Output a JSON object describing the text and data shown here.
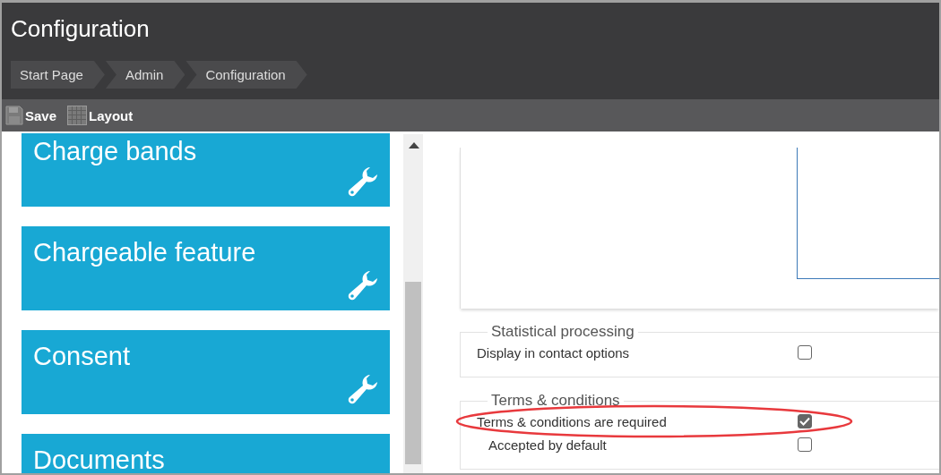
{
  "window": {
    "title": "Configuration"
  },
  "breadcrumbs": [
    "Start Page",
    "Admin",
    "Configuration"
  ],
  "toolbar": [
    {
      "label": "Save",
      "kind": "save"
    },
    {
      "label": "Layout",
      "kind": "layout"
    }
  ],
  "tiles": [
    {
      "label": "Charge bands"
    },
    {
      "label": "Chargeable feature"
    },
    {
      "label": "Consent"
    },
    {
      "label": "Documents"
    }
  ],
  "sections": [
    {
      "legend": "Statistical processing",
      "options": [
        {
          "label": "Display in contact options",
          "checked": false,
          "indented": false,
          "highlighted": false
        }
      ]
    },
    {
      "legend": "Terms & conditions",
      "options": [
        {
          "label": "Terms & conditions are required",
          "checked": true,
          "indented": false,
          "highlighted": true
        },
        {
          "label": "Accepted by default",
          "checked": false,
          "indented": true,
          "highlighted": false
        }
      ]
    }
  ]
}
